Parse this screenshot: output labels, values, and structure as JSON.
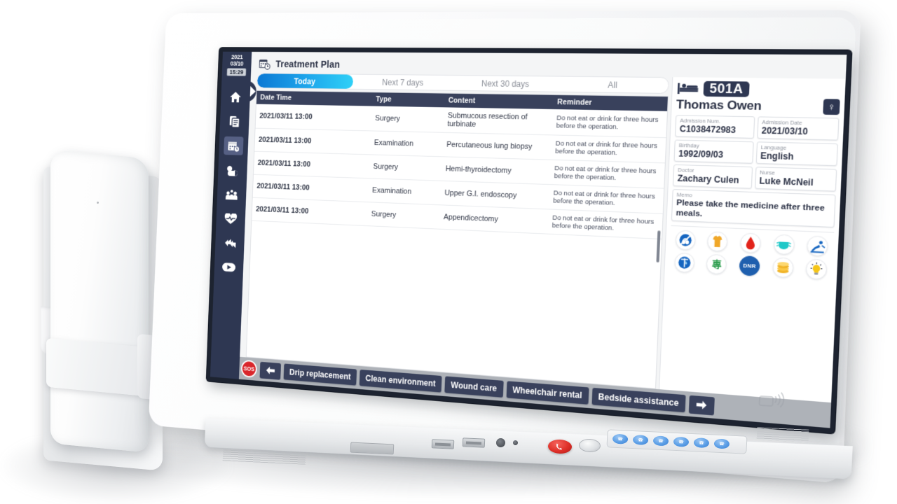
{
  "sidebar": {
    "date_line1": "2021",
    "date_line2": "03/10",
    "time": "15:29",
    "items": [
      {
        "name": "home",
        "label": "Home"
      },
      {
        "name": "documents",
        "label": "Documents"
      },
      {
        "name": "treatment-plan",
        "label": "Treatment Plan"
      },
      {
        "name": "weather",
        "label": "Weather"
      },
      {
        "name": "family",
        "label": "Family"
      },
      {
        "name": "health",
        "label": "Health"
      },
      {
        "name": "feedback",
        "label": "Feedback"
      },
      {
        "name": "video",
        "label": "Video"
      }
    ]
  },
  "header": {
    "title": "Treatment Plan",
    "icon": "calendar-clock-icon"
  },
  "tabs": [
    {
      "label": "Today",
      "active": true
    },
    {
      "label": "Next 7 days",
      "active": false
    },
    {
      "label": "Next 30 days",
      "active": false
    },
    {
      "label": "All",
      "active": false
    }
  ],
  "table": {
    "columns": [
      "Date Time",
      "Type",
      "Content",
      "Reminder"
    ],
    "rows": [
      {
        "datetime": "2021/03/11 13:00",
        "type": "Surgery",
        "content": "Submucous resection of turbinate",
        "reminder": "Do not eat or drink for three hours before the operation."
      },
      {
        "datetime": "2021/03/11 13:00",
        "type": "Examination",
        "content": "Percutaneous lung biopsy",
        "reminder": "Do not eat or drink for three hours before the operation."
      },
      {
        "datetime": "2021/03/11 13:00",
        "type": "Surgery",
        "content": "Hemi-thyroidectomy",
        "reminder": "Do not eat or drink for three hours before the operation."
      },
      {
        "datetime": "2021/03/11 13:00",
        "type": "Examination",
        "content": "Upper G.I. endoscopy",
        "reminder": "Do not eat or drink for three hours before the operation."
      },
      {
        "datetime": "2021/03/11 13:00",
        "type": "Surgery",
        "content": "Appendicectomy",
        "reminder": "Do not eat or drink for three hours before the operation."
      }
    ]
  },
  "patient": {
    "room": "501A",
    "bed_icon": "bed-icon",
    "name": "Thomas Owen",
    "gender_symbol": "♀",
    "fields": [
      {
        "label": "Admission Num.",
        "value": "C1038472983"
      },
      {
        "label": "Admission Date",
        "value": "2021/03/10"
      },
      {
        "label": "Birthday",
        "value": "1992/09/03"
      },
      {
        "label": "Language",
        "value": "English"
      },
      {
        "label": "Doctor",
        "value": "Zachary Culen"
      },
      {
        "label": "Nurse",
        "value": "Luke McNeil"
      }
    ],
    "memo": {
      "label": "Memo",
      "value": "Please take the medicine after three meals."
    },
    "status_icons": [
      {
        "name": "no-smoking-icon",
        "glyph": "⚬"
      },
      {
        "name": "patient-gown-icon",
        "glyph": "▮"
      },
      {
        "name": "blood-drop-icon",
        "glyph": "●"
      },
      {
        "name": "face-mask-icon",
        "glyph": "◑"
      },
      {
        "name": "fall-risk-icon",
        "glyph": "↗"
      },
      {
        "name": "iv-drip-icon",
        "glyph": "†"
      },
      {
        "name": "special-care-icon",
        "glyph": "專"
      },
      {
        "name": "dnr-icon",
        "glyph": "DNR"
      },
      {
        "name": "coins-icon",
        "glyph": "●"
      },
      {
        "name": "light-bulb-icon",
        "glyph": "●"
      }
    ]
  },
  "bottom_bar": {
    "sos_label": "SOS",
    "back_icon": "arrow-left-icon",
    "forward_icon": "arrow-right-icon",
    "actions": [
      "Drip replacement",
      "Clean environment",
      "Wound care",
      "Wheelchair rental",
      "Bedside assistance"
    ]
  },
  "device": {
    "nfc_icon": "nfc-icon",
    "emergency_button": "emergency-call-button",
    "hardware_buttons": [
      "btn-1",
      "btn-2",
      "btn-3",
      "btn-4",
      "btn-5",
      "btn-6"
    ]
  },
  "colors": {
    "navy": "#2e3752",
    "header_navy": "#39415c",
    "tab_blue_start": "#0b78d4",
    "tab_blue_end": "#2fd0f7",
    "sos_red": "#d9262b",
    "bar_gray": "#aeb2b8"
  }
}
